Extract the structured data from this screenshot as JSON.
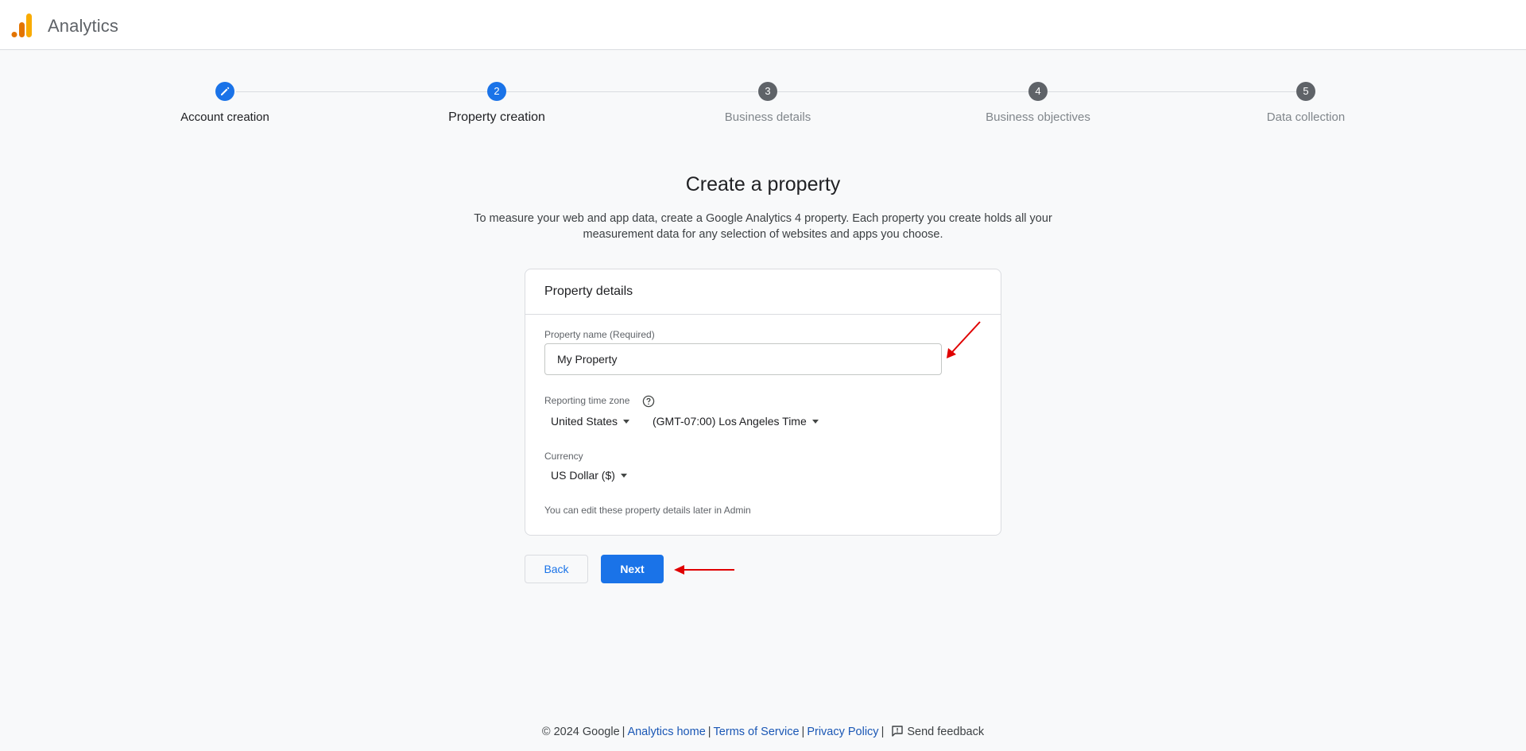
{
  "app": {
    "title": "Analytics",
    "logo_colors": [
      "#f9ab00",
      "#e37400"
    ]
  },
  "stepper": {
    "steps": [
      {
        "number": "",
        "label": "Account creation",
        "state": "done",
        "icon": "pencil-icon"
      },
      {
        "number": "2",
        "label": "Property creation",
        "state": "current"
      },
      {
        "number": "3",
        "label": "Business details",
        "state": "pending"
      },
      {
        "number": "4",
        "label": "Business objectives",
        "state": "pending"
      },
      {
        "number": "5",
        "label": "Data collection",
        "state": "pending"
      }
    ]
  },
  "page": {
    "title": "Create a property",
    "subtitle_line1": "To measure your web and app data, create a Google Analytics 4 property. Each property you create holds all your",
    "subtitle_line2": "measurement data for any selection of websites and apps you choose."
  },
  "card": {
    "header": "Property details",
    "property_name_label": "Property name (Required)",
    "property_name_value": "My Property",
    "timezone_label": "Reporting time zone",
    "help_icon": "help-circle-icon",
    "country_value": "United States",
    "timezone_value": "(GMT-07:00) Los Angeles Time",
    "currency_label": "Currency",
    "currency_value": "US Dollar ($)",
    "note": "You can edit these property details later in Admin"
  },
  "buttons": {
    "back": "Back",
    "next": "Next"
  },
  "footer": {
    "copyright": "© 2024 Google",
    "links": [
      "Analytics home",
      "Terms of Service",
      "Privacy Policy"
    ],
    "separator": "|",
    "feedback": "Send feedback",
    "feedback_icon": "feedback-icon"
  },
  "colors": {
    "primary": "#1a73e8",
    "annotation_arrow": "#e00000",
    "pending_step": "#5f6368"
  }
}
